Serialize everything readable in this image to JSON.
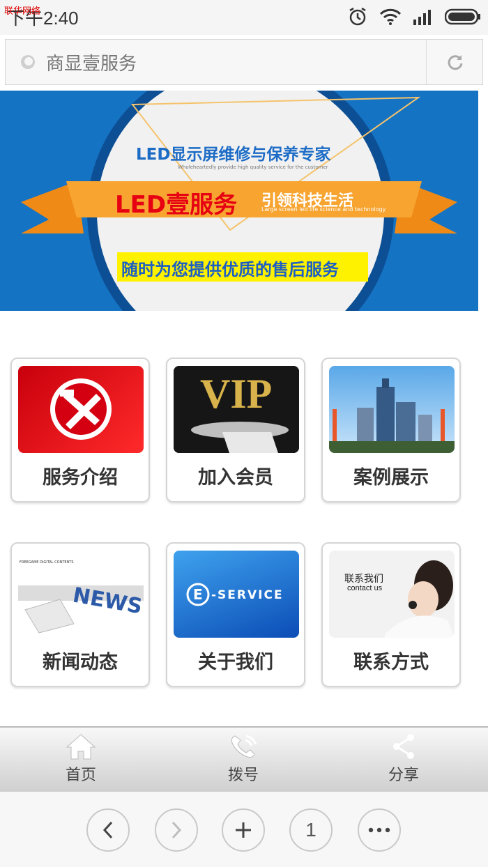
{
  "status_bar": {
    "time": "下午2:40",
    "watermark": "联华网络"
  },
  "url_bar": {
    "title": "商显壹服务"
  },
  "banner": {
    "headline": "LED显示屏维修与保养专家",
    "subline": "Wholeheartedly provide high quality service for the customer",
    "ribbon_main": "LED壹服务",
    "ribbon_side": "引领科技生活",
    "ribbon_small": "Large screen led life science and technology",
    "bottom_text": "随时为您提供优质的售后服务"
  },
  "cards": [
    {
      "label": "服务介绍",
      "image_text": ""
    },
    {
      "label": "加入会员",
      "image_text": "VIP"
    },
    {
      "label": "案例展示",
      "image_text": ""
    },
    {
      "label": "新闻动态",
      "image_text": "NEWS",
      "image_small": "FREEGAME DIGITAL CONTENTS"
    },
    {
      "label": "关于我们",
      "image_text": "-SERVICE",
      "image_letter": "E"
    },
    {
      "label": "联系方式",
      "image_text": "联系我们",
      "image_small": "contact us"
    }
  ],
  "toolbar": {
    "home": "首页",
    "dial": "拨号",
    "share": "分享"
  },
  "browser_nav": {
    "tabs_count": "1"
  },
  "colors": {
    "banner_blue": "#1573c4",
    "ribbon_orange": "#f39a25",
    "accent_red": "#e60012"
  }
}
